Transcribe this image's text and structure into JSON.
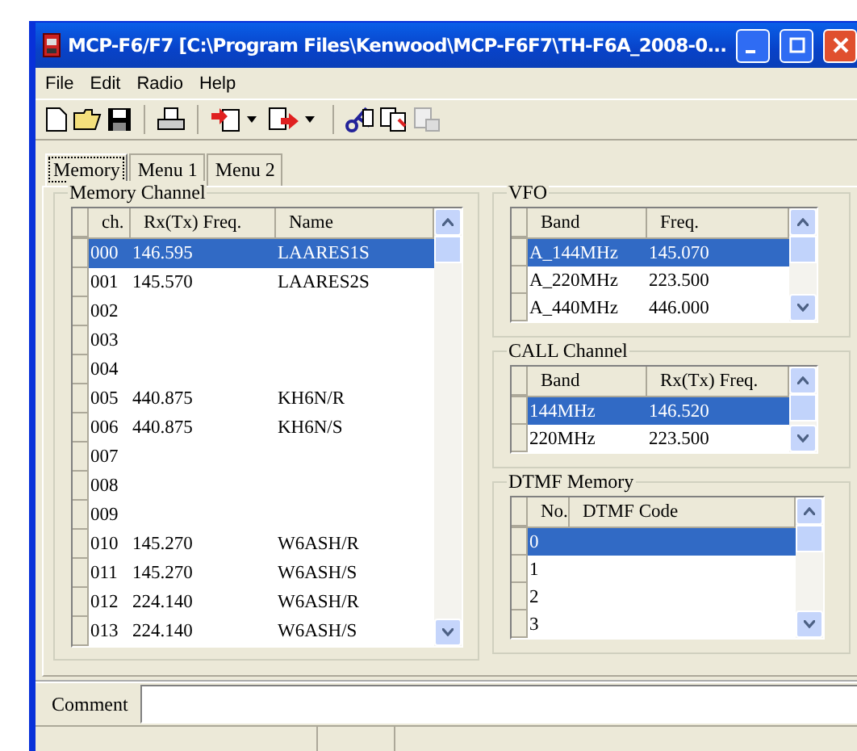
{
  "window": {
    "title": "MCP-F6/F7 [C:\\Program Files\\Kenwood\\MCP-F6F7\\TH-F6A_2008-0..."
  },
  "menu": [
    "File",
    "Edit",
    "Radio",
    "Help"
  ],
  "tabs": [
    {
      "label": "Memory",
      "selected": true
    },
    {
      "label": "Menu 1",
      "selected": false
    },
    {
      "label": "Menu 2",
      "selected": false
    }
  ],
  "memory_channel": {
    "title": "Memory Channel",
    "columns": [
      "ch.",
      "Rx(Tx) Freq.",
      "Name"
    ],
    "rows": [
      {
        "cells": [
          "000",
          "146.595",
          "LAARES1S"
        ],
        "selected": true
      },
      {
        "cells": [
          "001",
          "145.570",
          "LAARES2S"
        ],
        "selected": false
      },
      {
        "cells": [
          "002",
          "",
          ""
        ],
        "selected": false
      },
      {
        "cells": [
          "003",
          "",
          ""
        ],
        "selected": false
      },
      {
        "cells": [
          "004",
          "",
          ""
        ],
        "selected": false
      },
      {
        "cells": [
          "005",
          "440.875",
          "KH6N/R"
        ],
        "selected": false
      },
      {
        "cells": [
          "006",
          "440.875",
          "KH6N/S"
        ],
        "selected": false
      },
      {
        "cells": [
          "007",
          "",
          ""
        ],
        "selected": false
      },
      {
        "cells": [
          "008",
          "",
          ""
        ],
        "selected": false
      },
      {
        "cells": [
          "009",
          "",
          ""
        ],
        "selected": false
      },
      {
        "cells": [
          "010",
          "145.270",
          "W6ASH/R"
        ],
        "selected": false
      },
      {
        "cells": [
          "011",
          "145.270",
          "W6ASH/S"
        ],
        "selected": false
      },
      {
        "cells": [
          "012",
          "224.140",
          "W6ASH/R"
        ],
        "selected": false
      },
      {
        "cells": [
          "013",
          "224.140",
          "W6ASH/S"
        ],
        "selected": false
      }
    ]
  },
  "vfo": {
    "title": "VFO",
    "columns": [
      "Band",
      "Freq."
    ],
    "rows": [
      {
        "cells": [
          "A_144MHz",
          "145.070"
        ],
        "selected": true
      },
      {
        "cells": [
          "A_220MHz",
          "223.500"
        ],
        "selected": false
      },
      {
        "cells": [
          "A_440MHz",
          "446.000"
        ],
        "selected": false
      }
    ]
  },
  "call_channel": {
    "title": "CALL Channel",
    "columns": [
      "Band",
      "Rx(Tx) Freq."
    ],
    "rows": [
      {
        "cells": [
          "144MHz",
          "146.520"
        ],
        "selected": true
      },
      {
        "cells": [
          "220MHz",
          "223.500"
        ],
        "selected": false
      }
    ]
  },
  "dtmf_memory": {
    "title": "DTMF Memory",
    "columns": [
      "No.",
      "DTMF Code"
    ],
    "rows": [
      {
        "cells": [
          "0",
          ""
        ],
        "selected": true
      },
      {
        "cells": [
          "1",
          ""
        ],
        "selected": false
      },
      {
        "cells": [
          "2",
          ""
        ],
        "selected": false
      },
      {
        "cells": [
          "3",
          ""
        ],
        "selected": false
      }
    ]
  },
  "comment": {
    "label": "Comment"
  }
}
